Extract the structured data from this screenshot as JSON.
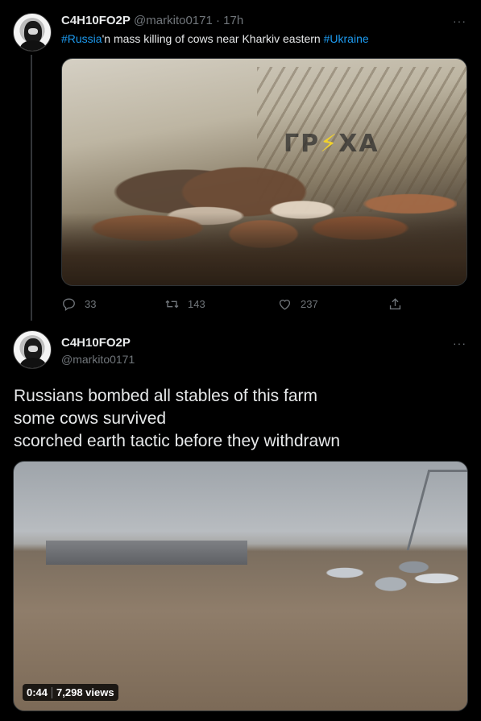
{
  "tweet1": {
    "display_name": "C4H10FO2P",
    "handle": "@markito0171",
    "separator": "·",
    "time": "17h",
    "text_parts": {
      "hashtag1": "#Russia",
      "middle": "'n mass killing of cows near Kharkiv eastern ",
      "hashtag2": "#Ukraine"
    },
    "media": {
      "watermark_left": "ГР",
      "watermark_right": "ХА"
    },
    "actions": {
      "replies": "33",
      "retweets": "143",
      "likes": "237"
    },
    "more": "···"
  },
  "tweet2": {
    "display_name": "C4H10FO2P",
    "handle": "@markito0171",
    "more": "···",
    "lines": [
      "Russians bombed all stables of this farm",
      "some cows survived",
      "scorched earth tactic before they withdrawn"
    ],
    "video": {
      "duration": "0:44",
      "views": "7,298 views"
    }
  },
  "colors": {
    "background": "#000000",
    "text": "#e7e9ea",
    "muted": "#71767b",
    "link": "#1d9bf0",
    "border": "#2f3336"
  },
  "icons": [
    "reply-icon",
    "retweet-icon",
    "like-icon",
    "share-icon",
    "more-icon"
  ]
}
